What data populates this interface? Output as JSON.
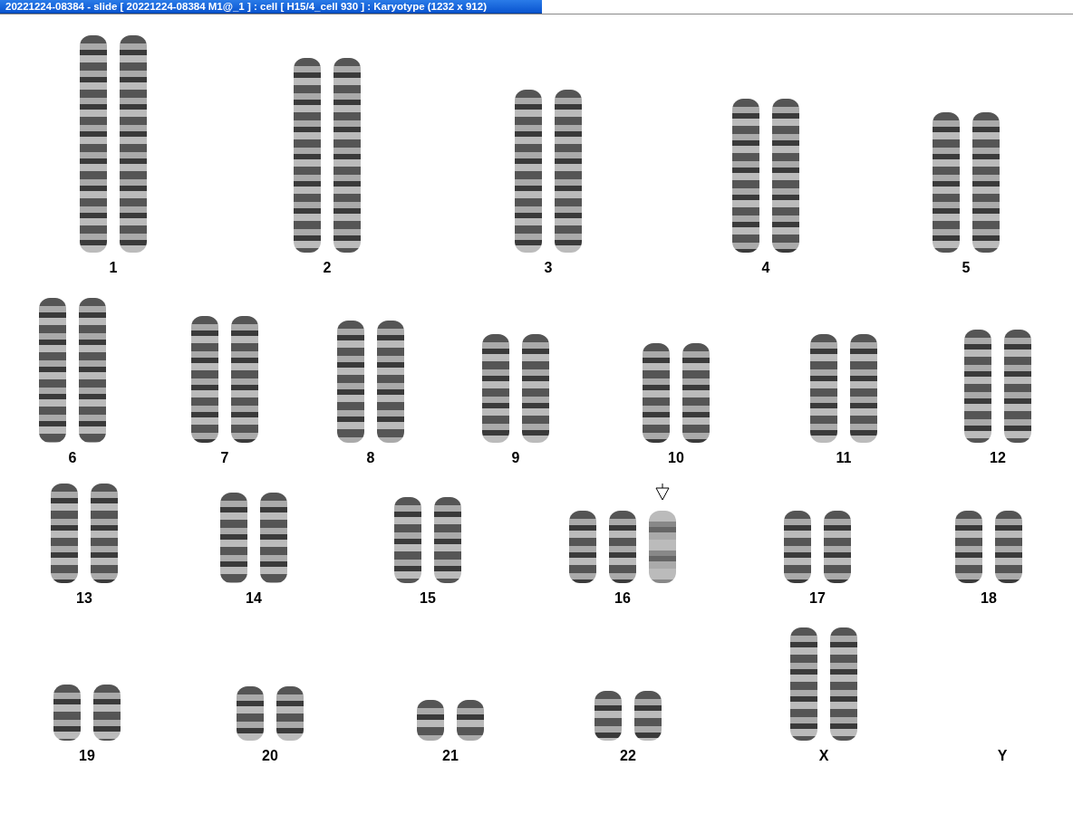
{
  "window": {
    "title": "20221224-08384 - slide [ 20221224-08384 M1@_1 ] : cell [ H15/4_cell 930 ] : Karyotype  (1232 x 912)"
  },
  "groups": [
    {
      "label": "1",
      "chromosomes": [
        {
          "marked": false
        },
        {
          "marked": false
        }
      ]
    },
    {
      "label": "2",
      "chromosomes": [
        {
          "marked": false
        },
        {
          "marked": false
        }
      ]
    },
    {
      "label": "3",
      "chromosomes": [
        {
          "marked": false
        },
        {
          "marked": false
        }
      ]
    },
    {
      "label": "4",
      "chromosomes": [
        {
          "marked": false
        },
        {
          "marked": false
        }
      ]
    },
    {
      "label": "5",
      "chromosomes": [
        {
          "marked": false
        },
        {
          "marked": false
        }
      ]
    },
    {
      "label": "6",
      "chromosomes": [
        {
          "marked": false
        },
        {
          "marked": false
        }
      ]
    },
    {
      "label": "7",
      "chromosomes": [
        {
          "marked": false
        },
        {
          "marked": false
        }
      ]
    },
    {
      "label": "8",
      "chromosomes": [
        {
          "marked": false
        },
        {
          "marked": false
        }
      ]
    },
    {
      "label": "9",
      "chromosomes": [
        {
          "marked": false
        },
        {
          "marked": false
        }
      ]
    },
    {
      "label": "10",
      "chromosomes": [
        {
          "marked": false
        },
        {
          "marked": false
        }
      ]
    },
    {
      "label": "11",
      "chromosomes": [
        {
          "marked": false
        },
        {
          "marked": false
        }
      ]
    },
    {
      "label": "12",
      "chromosomes": [
        {
          "marked": false
        },
        {
          "marked": false
        }
      ]
    },
    {
      "label": "13",
      "chromosomes": [
        {
          "marked": false
        },
        {
          "marked": false
        }
      ]
    },
    {
      "label": "14",
      "chromosomes": [
        {
          "marked": false
        },
        {
          "marked": false
        }
      ]
    },
    {
      "label": "15",
      "chromosomes": [
        {
          "marked": false
        },
        {
          "marked": false
        }
      ]
    },
    {
      "label": "16",
      "chromosomes": [
        {
          "marked": false
        },
        {
          "marked": false
        },
        {
          "marked": true
        }
      ]
    },
    {
      "label": "17",
      "chromosomes": [
        {
          "marked": false
        },
        {
          "marked": false
        }
      ]
    },
    {
      "label": "18",
      "chromosomes": [
        {
          "marked": false
        },
        {
          "marked": false
        }
      ]
    },
    {
      "label": "19",
      "chromosomes": [
        {
          "marked": false
        },
        {
          "marked": false
        }
      ]
    },
    {
      "label": "20",
      "chromosomes": [
        {
          "marked": false
        },
        {
          "marked": false
        }
      ]
    },
    {
      "label": "21",
      "chromosomes": [
        {
          "marked": false
        },
        {
          "marked": false
        }
      ]
    },
    {
      "label": "22",
      "chromosomes": [
        {
          "marked": false
        },
        {
          "marked": false
        }
      ]
    },
    {
      "label": "X",
      "chromosomes": [
        {
          "marked": false
        },
        {
          "marked": false
        }
      ]
    },
    {
      "label": "Y"
    }
  ]
}
